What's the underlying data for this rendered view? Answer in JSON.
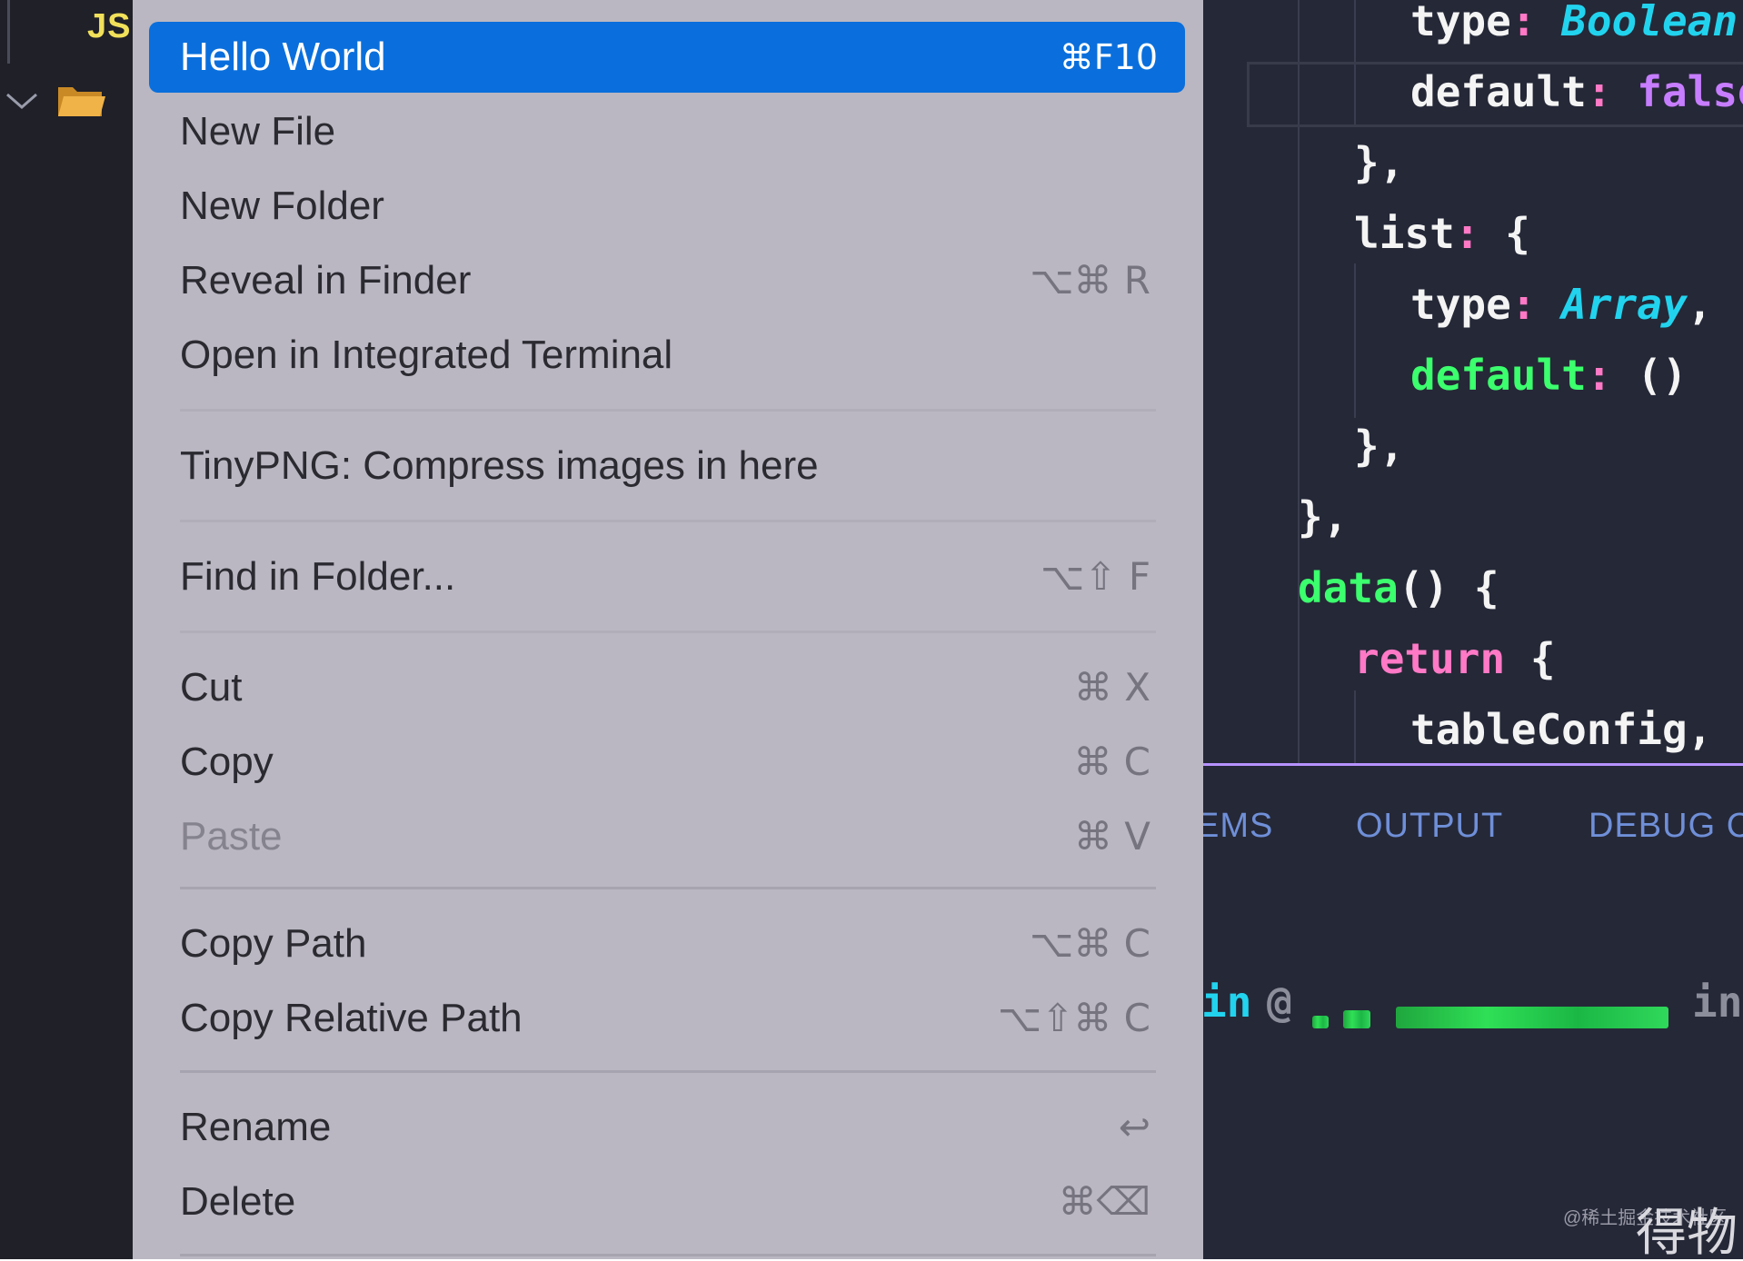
{
  "sidebar": {
    "file_badge": "JS",
    "colors": {
      "badge": "#f1e05a",
      "folder": "#e8a43a"
    }
  },
  "context_menu": {
    "items": [
      {
        "label": "Hello World",
        "shortcut": "⌘F10",
        "selected": true
      },
      {
        "label": "New File",
        "shortcut": ""
      },
      {
        "label": "New Folder",
        "shortcut": ""
      },
      {
        "label": "Reveal in Finder",
        "shortcut": "⌥⌘ R"
      },
      {
        "label": "Open in Integrated Terminal",
        "shortcut": ""
      },
      {
        "label": "TinyPNG: Compress images in here",
        "shortcut": ""
      },
      {
        "label": "Find in Folder...",
        "shortcut": "⌥⇧ F"
      },
      {
        "label": "Cut",
        "shortcut": "⌘ X"
      },
      {
        "label": "Copy",
        "shortcut": "⌘ C"
      },
      {
        "label": "Paste",
        "shortcut": "⌘ V",
        "disabled": true
      },
      {
        "label": "Copy Path",
        "shortcut": "⌥⌘ C"
      },
      {
        "label": "Copy Relative Path",
        "shortcut": "⌥⇧⌘ C"
      },
      {
        "label": "Rename",
        "shortcut": "↩"
      },
      {
        "label": "Delete",
        "shortcut": "⌘⌫"
      }
    ],
    "colors": {
      "selected": "#0a6fdc",
      "background": "#bab7c2"
    }
  },
  "editor": {
    "lines": [
      [
        {
          "t": "type",
          "c": "white"
        },
        {
          "t": ": ",
          "c": "pink"
        },
        {
          "t": "Boolean",
          "c": "cyan"
        }
      ],
      [
        {
          "t": "default",
          "c": "white"
        },
        {
          "t": ": ",
          "c": "pink"
        },
        {
          "t": "false",
          "c": "purple"
        }
      ],
      [
        {
          "t": "},",
          "c": "white"
        }
      ],
      [
        {
          "t": "list",
          "c": "white"
        },
        {
          "t": ": ",
          "c": "pink"
        },
        {
          "t": "{",
          "c": "white"
        }
      ],
      [
        {
          "t": "type",
          "c": "white"
        },
        {
          "t": ": ",
          "c": "pink"
        },
        {
          "t": "Array",
          "c": "cyan"
        },
        {
          "t": ",",
          "c": "white"
        }
      ],
      [
        {
          "t": "default",
          "c": "green"
        },
        {
          "t": ": ",
          "c": "pink"
        },
        {
          "t": "()",
          "c": "white"
        }
      ],
      [
        {
          "t": "},",
          "c": "white"
        }
      ],
      [
        {
          "t": "},",
          "c": "white"
        }
      ],
      [
        {
          "t": "data",
          "c": "green"
        },
        {
          "t": "() {",
          "c": "white"
        }
      ],
      [
        {
          "t": "return",
          "c": "pink"
        },
        {
          "t": " {",
          "c": "white"
        }
      ],
      [
        {
          "t": "tableConfig,",
          "c": "white"
        }
      ]
    ]
  },
  "panel": {
    "tabs": [
      "EMS",
      "OUTPUT",
      "DEBUG C"
    ],
    "terminal_prefix": "in",
    "terminal_at": "@",
    "terminal_suffix": "in"
  },
  "watermark": {
    "small": "@稀土掘金技术社区",
    "large": "得物"
  }
}
